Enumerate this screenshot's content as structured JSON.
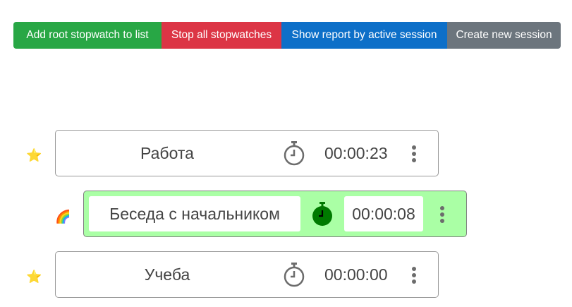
{
  "toolbar": {
    "add_root": "Add root stopwatch to list",
    "stop_all": "Stop all stopwatches",
    "show_report": "Show report by active session",
    "create_session": "Create new session"
  },
  "stopwatches": [
    {
      "name": "Работа",
      "time": "00:00:23",
      "icon": "star-icon",
      "running": false
    },
    {
      "name": "Беседа с начальником",
      "time": "00:00:08",
      "icon": "rainbow-icon",
      "running": true
    },
    {
      "name": "Учеба",
      "time": "00:00:00",
      "icon": "star-icon",
      "running": false
    }
  ],
  "colors": {
    "active_bg": "#aaffa5",
    "running_icon": "#007a00",
    "idle_icon": "#6c6c6c"
  }
}
